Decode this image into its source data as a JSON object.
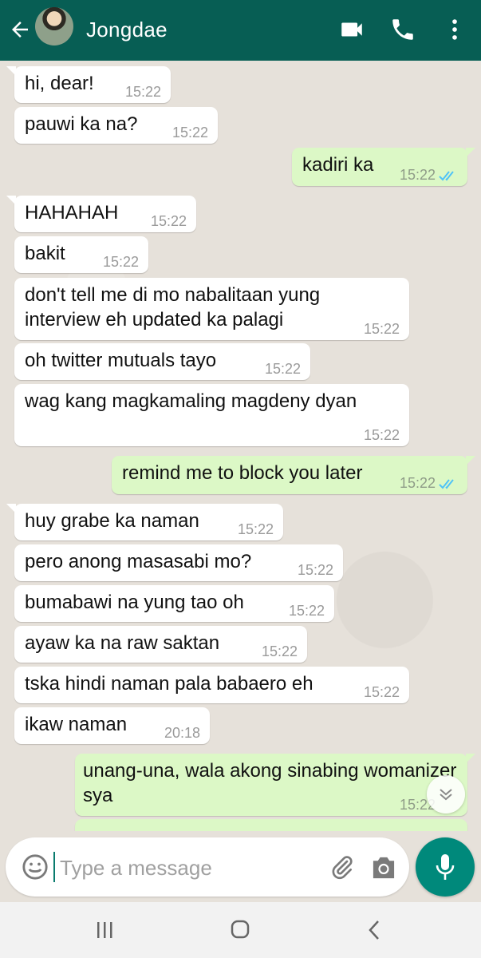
{
  "header": {
    "contact_name": "Jongdae",
    "back_icon": "arrow-left-icon",
    "video_icon": "video-call-icon",
    "call_icon": "phone-icon",
    "menu_icon": "more-vertical-icon"
  },
  "messages": [
    {
      "text": "hi, dear!",
      "time": "15:22"
    },
    {
      "text": "pauwi ka na?",
      "time": "15:22"
    },
    {
      "text": "kadiri ka",
      "time": "15:22"
    },
    {
      "text": "HAHAHAH",
      "time": "15:22"
    },
    {
      "text": "bakit",
      "time": "15:22"
    },
    {
      "text": "don't tell me di mo nabalitaan yung interview eh updated ka palagi",
      "time": "15:22"
    },
    {
      "text": "oh twitter mutuals tayo",
      "time": "15:22"
    },
    {
      "text": "wag kang magkamaling magdeny dyan",
      "time": "15:22"
    },
    {
      "text": "remind me to block you later",
      "time": "15:22"
    },
    {
      "text": "huy grabe ka naman",
      "time": "15:22"
    },
    {
      "text": "pero anong masasabi mo?",
      "time": "15:22"
    },
    {
      "text": "bumabawi na yung tao oh",
      "time": "15:22"
    },
    {
      "text": "ayaw ka na raw saktan",
      "time": "15:22"
    },
    {
      "text": "tska hindi naman pala babaero eh",
      "time": "15:22"
    },
    {
      "text": "ikaw naman",
      "time": "20:18"
    },
    {
      "text": "unang-una, wala akong sinabing womanizer sya",
      "time": "15:22"
    }
  ],
  "composer": {
    "placeholder": "Type a message"
  },
  "colors": {
    "header_bg": "#075e54",
    "outgoing_bubble": "#dcf8c6",
    "incoming_bubble": "#ffffff",
    "accent": "#00897b",
    "read_ticks": "#4fc3f7"
  }
}
